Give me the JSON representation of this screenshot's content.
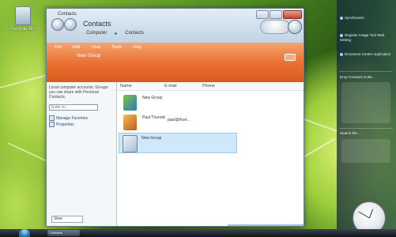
{
  "desktop": {
    "icons": [
      {
        "label": "Recycle Bin",
        "icon": "recycle-bin-icon"
      }
    ]
  },
  "window": {
    "title": "Contacts",
    "heading": "Contacts",
    "breadcrumbs": [
      "Computer",
      "Contacts"
    ],
    "menu": [
      "File",
      "Edit",
      "View",
      "Tools",
      "Help"
    ],
    "toolbar": {
      "new_group": "New Group"
    },
    "left_pane": {
      "description": "Local computer accounts. Groups you can share with Personal Contacts.",
      "input_placeholder": "Enter to...",
      "links": [
        "Manage Favorites",
        "Properties"
      ],
      "status": "View"
    },
    "columns": [
      "Name",
      "E-mail",
      "Phone"
    ],
    "contacts": [
      {
        "name": "New Group",
        "email": "",
        "icon": "group-contact-icon",
        "selected": false
      },
      {
        "name": "Paul Thurrott",
        "email": "paul@thurr...",
        "icon": "person-contact-icon",
        "selected": false
      },
      {
        "name": "New Group",
        "email": "",
        "icon": "new-group-icon",
        "selected": true
      }
    ]
  },
  "sidebar": {
    "items": [
      {
        "label": "Synchronize"
      },
      {
        "label": "Register Image Tool Web Setting"
      },
      {
        "label": "Document Center Application"
      }
    ],
    "section_title": "Drop Contacts to Be...",
    "search_label": "Search the...",
    "clock_label": "Clock"
  },
  "taskbar": {
    "buttons": [
      {
        "label": "Contacts"
      }
    ]
  },
  "colors": {
    "accent_orange": "#e96f2f",
    "selection": "#cfe8fb",
    "titlebar": "#c1d3e4"
  }
}
